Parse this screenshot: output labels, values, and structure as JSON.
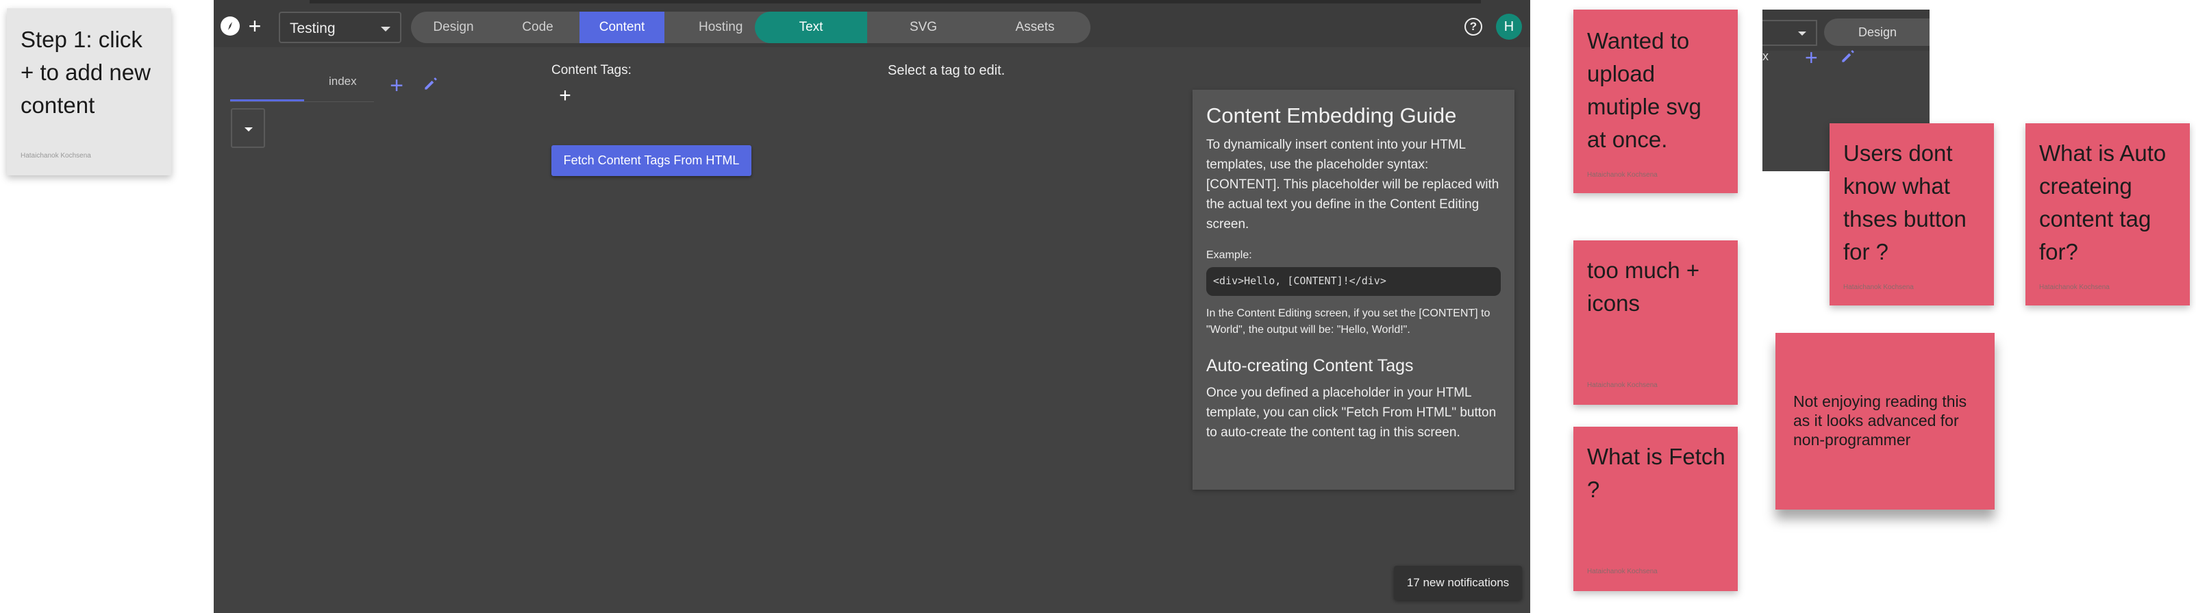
{
  "step_note": {
    "text": "Step 1:  click + to add new content",
    "author": "Hataichanok Kochsena"
  },
  "app": {
    "project_select": "Testing",
    "main_tabs": [
      "Design",
      "Code",
      "Content",
      "Hosting"
    ],
    "active_main_tab": "Content",
    "sub_tabs": [
      "Text",
      "SVG",
      "Assets"
    ],
    "active_sub_tab": "Text",
    "avatar_letter": "H",
    "page_tab": "index",
    "content_tags_label": "Content Tags:",
    "fetch_button": "Fetch Content Tags From HTML",
    "select_tag_message": "Select a tag to edit.",
    "guide": {
      "title": "Content Embedding Guide",
      "intro": "To dynamically insert content into your HTML templates, use the placeholder syntax: [CONTENT]. This placeholder will be replaced with the actual text you define in the Content Editing screen.",
      "example_label": "Example:",
      "example_code": "<div>Hello, [CONTENT]!</div>",
      "example_note": "In the Content Editing screen, if you set the [CONTENT] to \"World\", the output will be: \"Hello, World!\".",
      "subheading": "Auto-creating Content Tags",
      "auto_text": "Once you defined a placeholder in your HTML template, you can click \"Fetch From HTML\" button to auto-create the content tag in this screen."
    },
    "notifications": "17 new notifications"
  },
  "stickies": [
    {
      "text": "Wanted to upload mutiple svg at once.",
      "author": "Hataichanok Kochsena"
    },
    {
      "text": "too much + icons",
      "author": "Hataichanok Kochsena"
    },
    {
      "text": "What is Fetch ?",
      "author": "Hataichanok Kochsena"
    },
    {
      "text": "Users dont know what thses button for ?",
      "author": "Hataichanok Kochsena"
    },
    {
      "text": "What is Auto createing content tag for?",
      "author": "Hataichanok Kochsena"
    },
    {
      "text": "Not enjoying reading this as it looks advanced for non-programmer",
      "author": ""
    }
  ],
  "mini_screenshot": {
    "tab_label": "Design",
    "close_glyph": "x"
  },
  "colors": {
    "sticky_pink": "#e35a70",
    "accent_blue": "#5568e0",
    "accent_teal": "#148a7a"
  }
}
